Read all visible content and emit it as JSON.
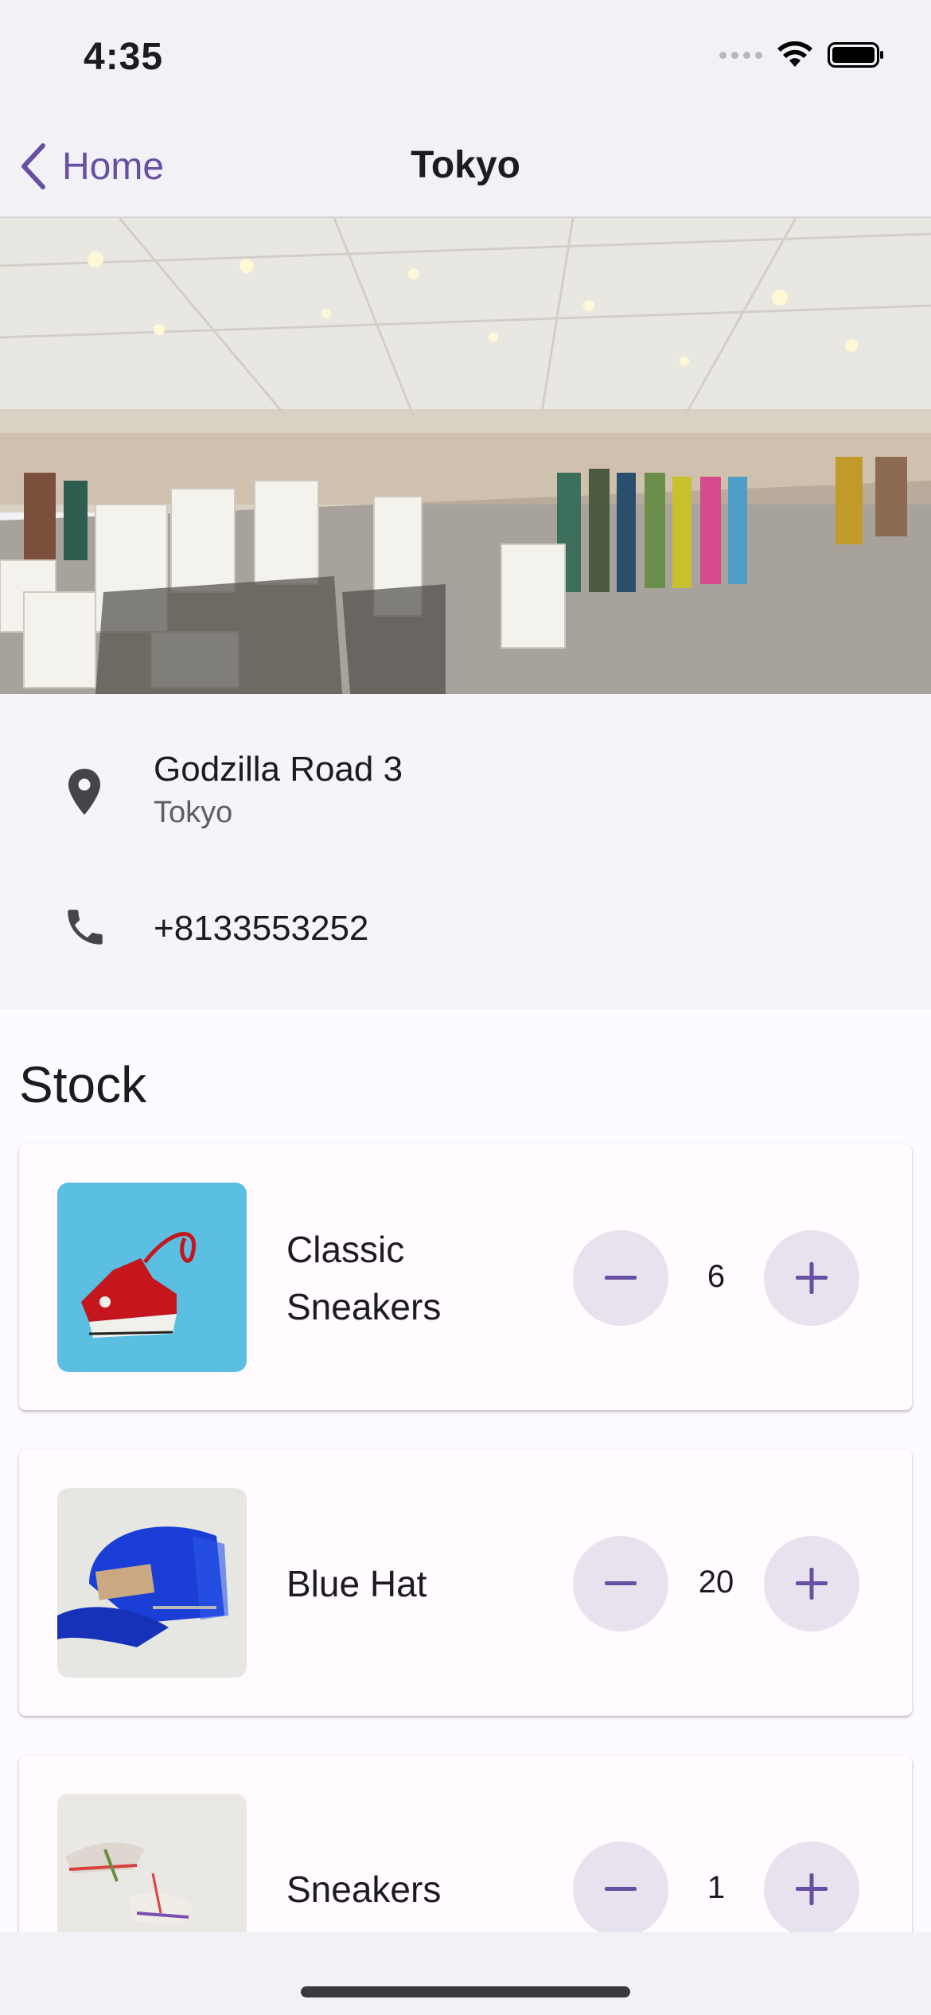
{
  "status_bar": {
    "time": "4:35"
  },
  "nav": {
    "back_label": "Home",
    "title": "Tokyo"
  },
  "store": {
    "address_line1": "Godzilla Road 3",
    "address_line2": "Tokyo",
    "phone": "+8133553252"
  },
  "stock": {
    "title": "Stock",
    "items": [
      {
        "name": "Classic Sneakers",
        "quantity": "6"
      },
      {
        "name": "Blue Hat",
        "quantity": "20"
      },
      {
        "name": "Sneakers",
        "quantity": "1"
      }
    ]
  },
  "colors": {
    "accent": "#6750a4",
    "stepper_bg": "#e8e2ee",
    "card_bg": "#fffbfe"
  }
}
